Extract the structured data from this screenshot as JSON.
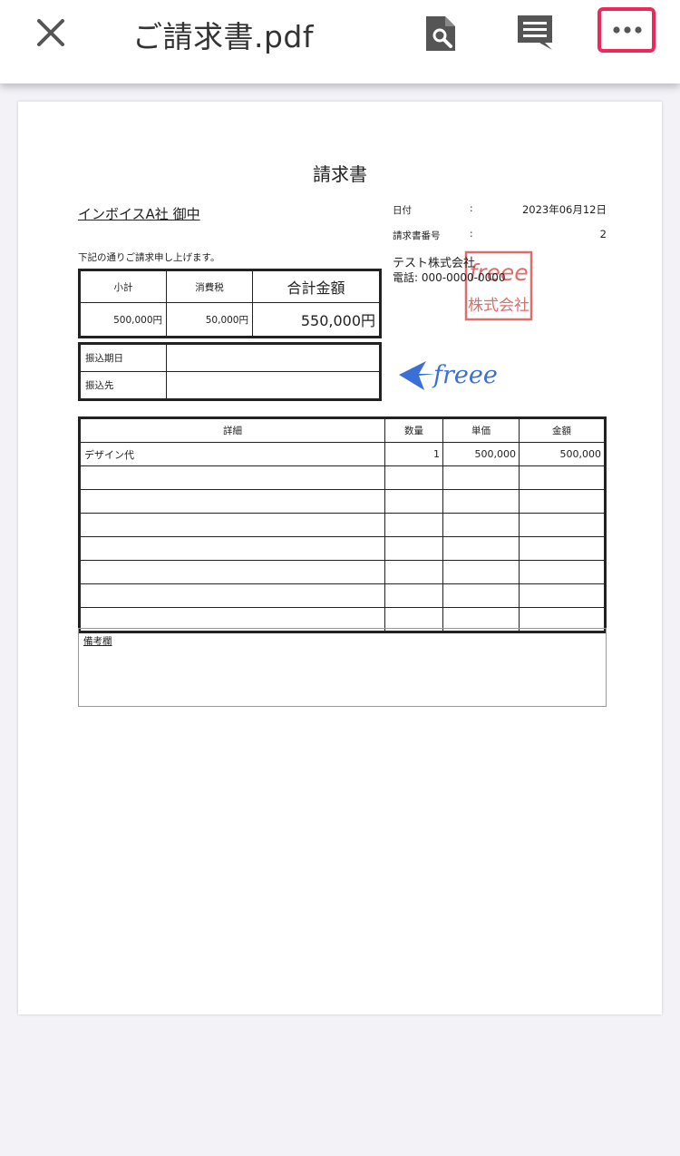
{
  "toolbar": {
    "title": "ご請求書.pdf",
    "icons": [
      "close-icon",
      "file-search-icon",
      "comment-icon",
      "more-horizontal-icon"
    ],
    "accent_color": "#f0275a"
  },
  "document": {
    "title": "請求書",
    "customer": "インボイスA社 御中",
    "intro_note": "下記の通りご請求申し上げます。",
    "meta": {
      "date_label": "日付",
      "date_value": "2023年06月12日",
      "number_label": "請求書番号",
      "number_value": "2",
      "colon": ":"
    },
    "issuer": {
      "company": "テスト株式会社",
      "phone": "電話: 000-0000-0000",
      "seal_text_top": "freee",
      "seal_text_bottom": "株式会社",
      "seal_color": "#d9534f",
      "logo_text": "freee",
      "logo_color": "#3a6fd8"
    },
    "summary": {
      "headers": [
        "小計",
        "消費税",
        "合計金額"
      ],
      "values": [
        "500,000円",
        "50,000円",
        "550,000円"
      ]
    },
    "payment": {
      "due_label": "振込期日",
      "due_value": "",
      "account_label": "振込先",
      "account_value": ""
    },
    "details": {
      "headers": [
        "詳細",
        "数量",
        "単価",
        "金額"
      ],
      "rows": [
        [
          "デザイン代",
          "1",
          "500,000",
          "500,000"
        ],
        [
          "",
          "",
          "",
          ""
        ],
        [
          "",
          "",
          "",
          ""
        ],
        [
          "",
          "",
          "",
          ""
        ],
        [
          "",
          "",
          "",
          ""
        ],
        [
          "",
          "",
          "",
          ""
        ],
        [
          "",
          "",
          "",
          ""
        ],
        [
          "",
          "",
          "",
          ""
        ]
      ]
    },
    "remarks_label": "備考欄"
  }
}
